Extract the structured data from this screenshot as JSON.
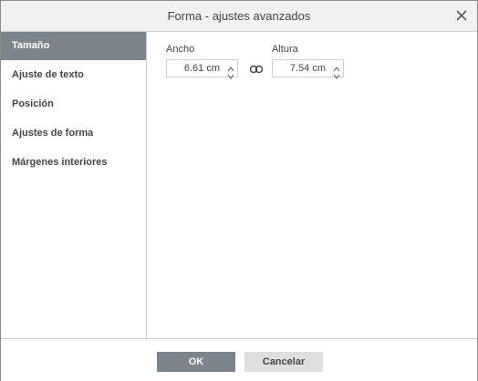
{
  "dialog": {
    "title": "Forma - ajustes avanzados"
  },
  "sidebar": {
    "items": [
      {
        "label": "Tamaño",
        "active": true
      },
      {
        "label": "Ajuste de texto",
        "active": false
      },
      {
        "label": "Posición",
        "active": false
      },
      {
        "label": "Ajustes de forma",
        "active": false
      },
      {
        "label": "Márgenes interiores",
        "active": false
      }
    ]
  },
  "size": {
    "width_label": "Ancho",
    "width_value": "6.61 cm",
    "height_label": "Altura",
    "height_value": "7.54 cm"
  },
  "footer": {
    "ok_label": "OK",
    "cancel_label": "Cancelar"
  },
  "colors": {
    "accent": "#7d858c",
    "title_bar": "#f1f1f1",
    "secondary_button": "#dfdfdf"
  },
  "icons": {
    "close": "close-icon",
    "link": "link-icon",
    "spin_up": "chevron-up-icon",
    "spin_down": "chevron-down-icon"
  }
}
